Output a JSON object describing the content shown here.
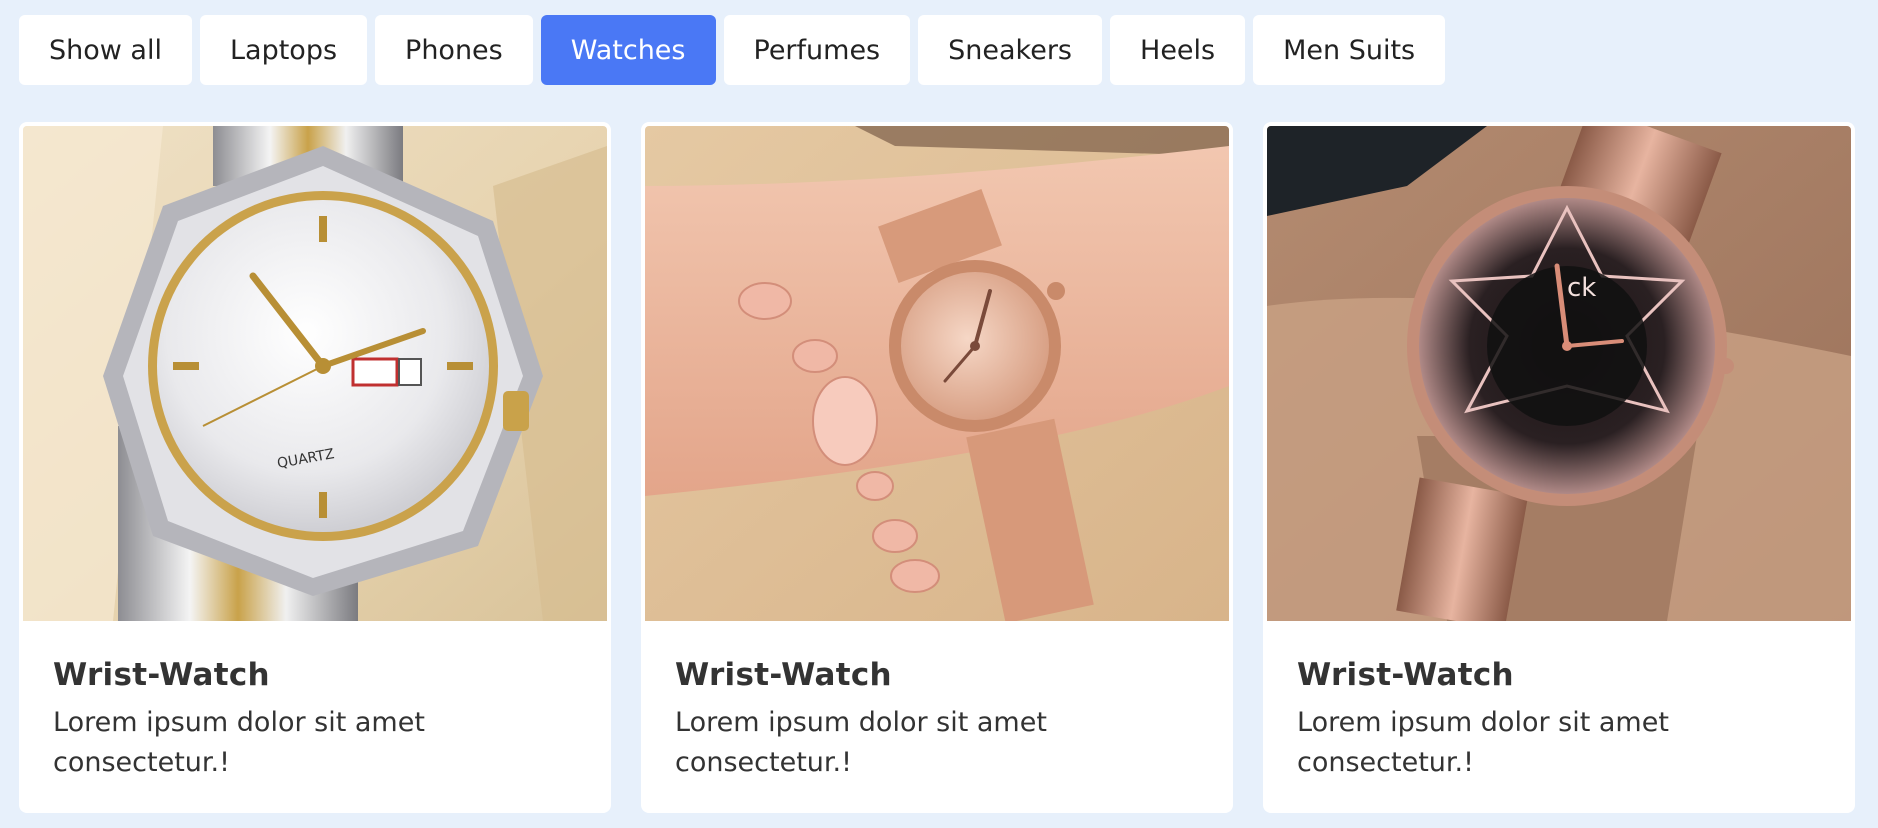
{
  "filters": [
    {
      "label": "Show all",
      "active": false
    },
    {
      "label": "Laptops",
      "active": false
    },
    {
      "label": "Phones",
      "active": false
    },
    {
      "label": "Watches",
      "active": true
    },
    {
      "label": "Perfumes",
      "active": false
    },
    {
      "label": "Sneakers",
      "active": false
    },
    {
      "label": "Heels",
      "active": false
    },
    {
      "label": "Men Suits",
      "active": false
    }
  ],
  "colors": {
    "background": "#e7f0fb",
    "active_filter": "#4a78f5",
    "card": "#ffffff"
  },
  "cards": [
    {
      "title": "Wrist-Watch",
      "text": "Lorem ipsum dolor sit amet consectetur.!",
      "image": "watch-silver-gold-photo"
    },
    {
      "title": "Wrist-Watch",
      "text": "Lorem ipsum dolor sit amet consectetur.!",
      "image": "watch-rose-gold-bracelet-photo"
    },
    {
      "title": "Wrist-Watch",
      "text": "Lorem ipsum dolor sit amet consectetur.!",
      "image": "watch-rose-gold-black-dial-photo"
    }
  ]
}
